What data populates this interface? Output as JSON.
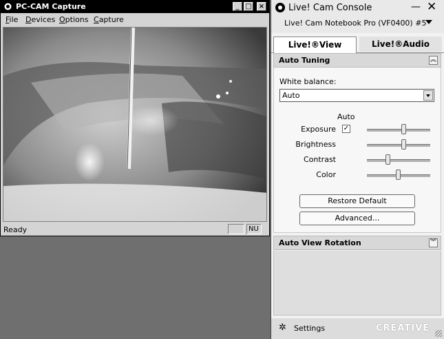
{
  "capture_window": {
    "title": "PC-CAM Capture",
    "menu": [
      "File",
      "Devices",
      "Options",
      "Capture"
    ],
    "status_text": "Ready",
    "status_pane_2": "NU",
    "window_buttons": {
      "minimize": "_",
      "maximize": "□",
      "close": "×"
    }
  },
  "console": {
    "title": "Live! Cam Console",
    "minimize": "—",
    "close": "✕",
    "camera_name": "Live! Cam Notebook Pro (VF0400) #5",
    "tabs": [
      {
        "label": "Live!®View",
        "active": true
      },
      {
        "label": "Live!®Audio",
        "active": false
      }
    ],
    "auto_tuning": {
      "header": "Auto Tuning",
      "collapse_glyph": "︽",
      "white_balance_label": "White balance:",
      "white_balance_value": "Auto",
      "auto_header": "Auto",
      "exposure_checked_glyph": "✓",
      "sliders": [
        {
          "label": "Exposure",
          "value_fraction": 0.58,
          "auto": true
        },
        {
          "label": "Brightness",
          "value_fraction": 0.58
        },
        {
          "label": "Contrast",
          "value_fraction": 0.33
        },
        {
          "label": "Color",
          "value_fraction": 0.49
        }
      ],
      "restore_button": "Restore Default",
      "advanced_button": "Advanced..."
    },
    "auto_view_rotation": {
      "header": "Auto View Rotation",
      "expand_glyph": "︾"
    },
    "footer": {
      "settings_label": "Settings",
      "gear_glyph": "✲",
      "brand": "CREATIVE"
    }
  }
}
